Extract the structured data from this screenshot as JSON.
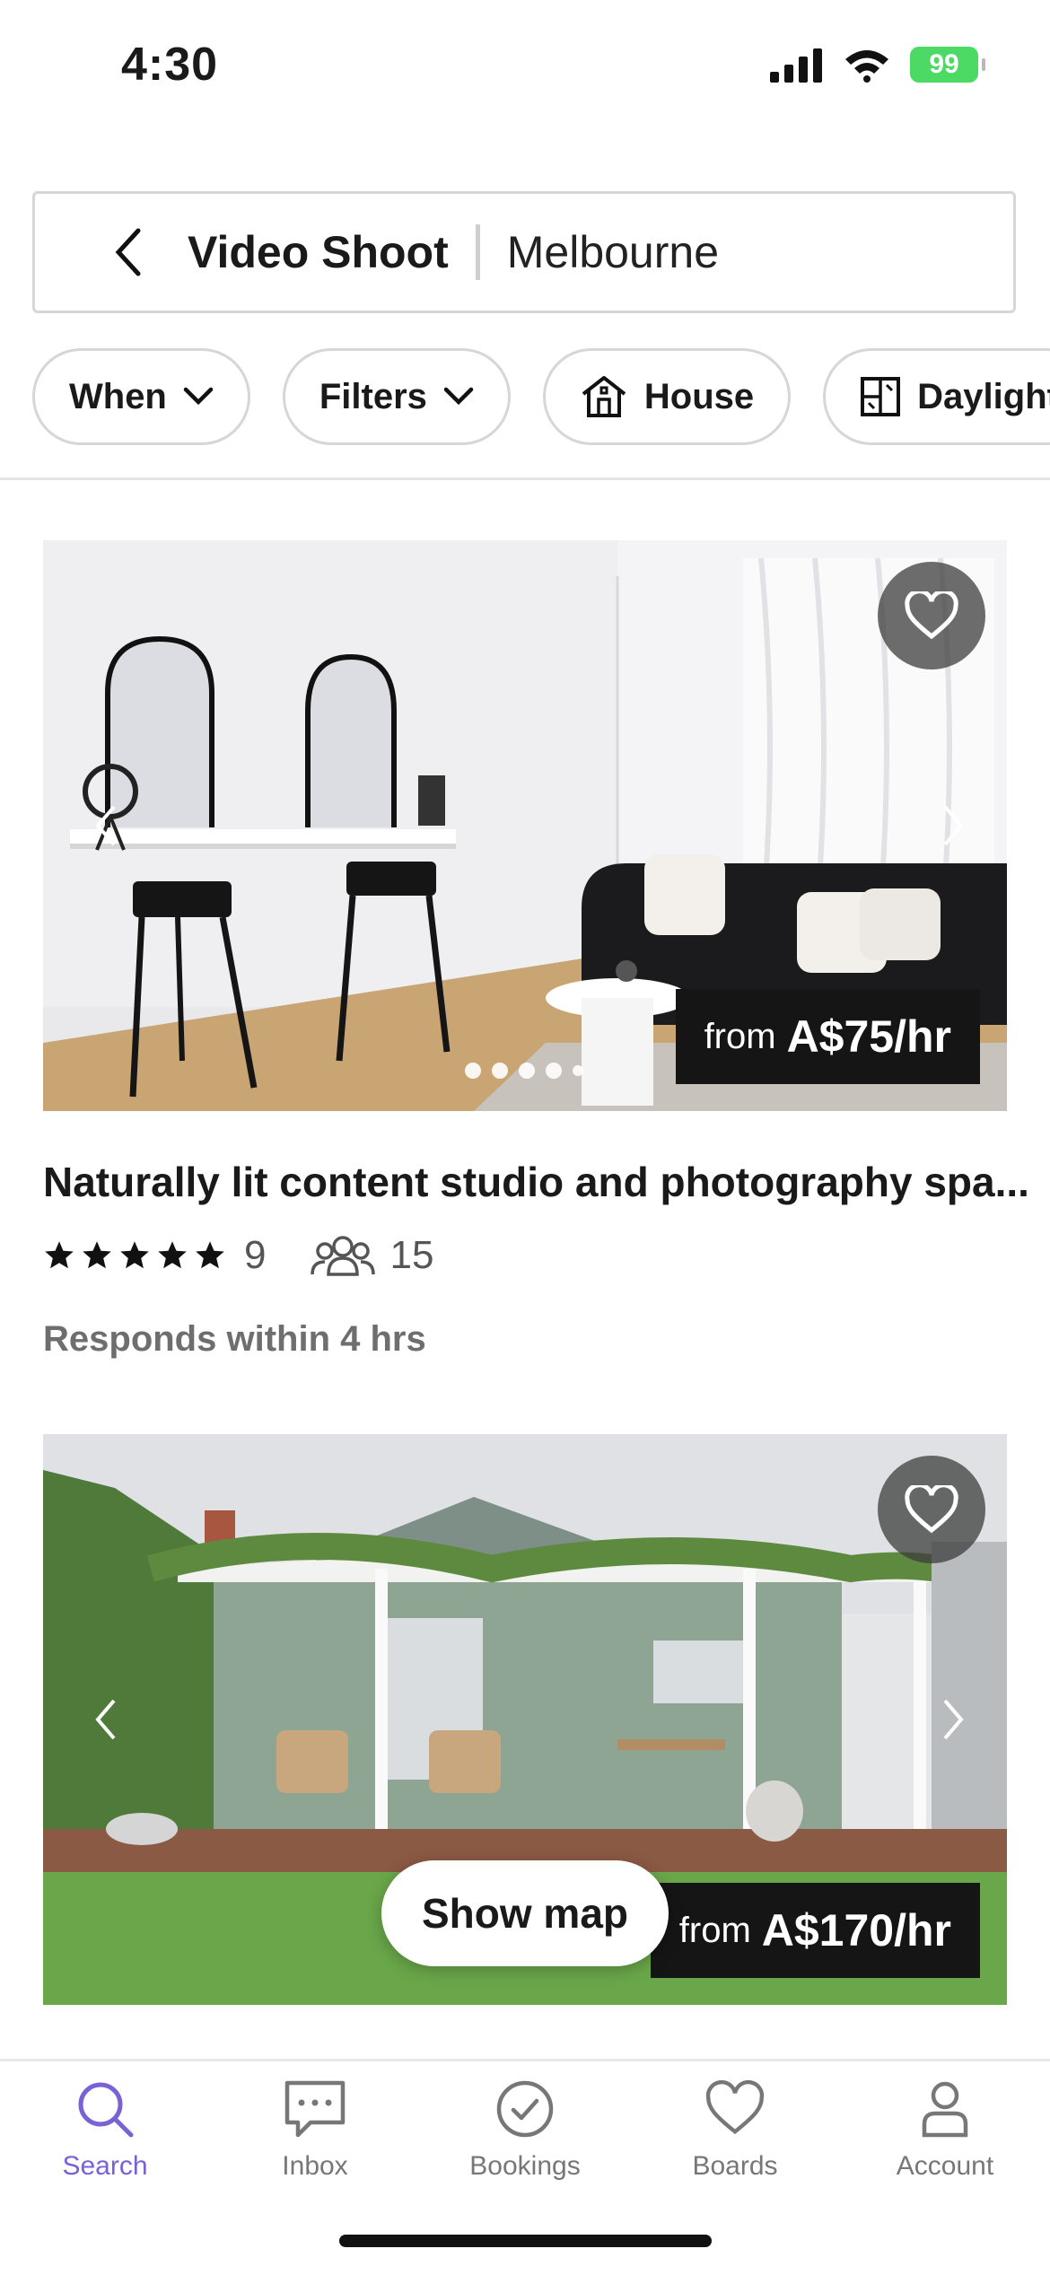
{
  "status_bar": {
    "time": "4:30",
    "battery": "99"
  },
  "search": {
    "activity": "Video Shoot",
    "location": "Melbourne"
  },
  "filters": [
    {
      "label": "When",
      "icon": "chevron-down-icon"
    },
    {
      "label": "Filters",
      "icon": "chevron-down-icon"
    },
    {
      "label": "House",
      "icon": "house-icon"
    },
    {
      "label": "Daylight",
      "icon": "window-icon"
    }
  ],
  "listings": [
    {
      "title": "Naturally lit content studio and photography spa...",
      "price_prefix": "from",
      "price": "A$75/hr",
      "reviews": "9",
      "capacity": "15",
      "responds": "Responds within 4 hrs",
      "photo_count": 5,
      "stars": 5
    },
    {
      "price_prefix": "from",
      "price": "A$170/hr"
    }
  ],
  "show_map_label": "Show map",
  "bottom_nav": [
    {
      "label": "Search",
      "icon": "search-icon",
      "active": true
    },
    {
      "label": "Inbox",
      "icon": "chat-icon",
      "active": false
    },
    {
      "label": "Bookings",
      "icon": "check-circle-icon",
      "active": false
    },
    {
      "label": "Boards",
      "icon": "heart-icon",
      "active": false
    },
    {
      "label": "Account",
      "icon": "person-icon",
      "active": false
    }
  ],
  "colors": {
    "accent": "#7b61d6",
    "price_bg": "#151515"
  }
}
